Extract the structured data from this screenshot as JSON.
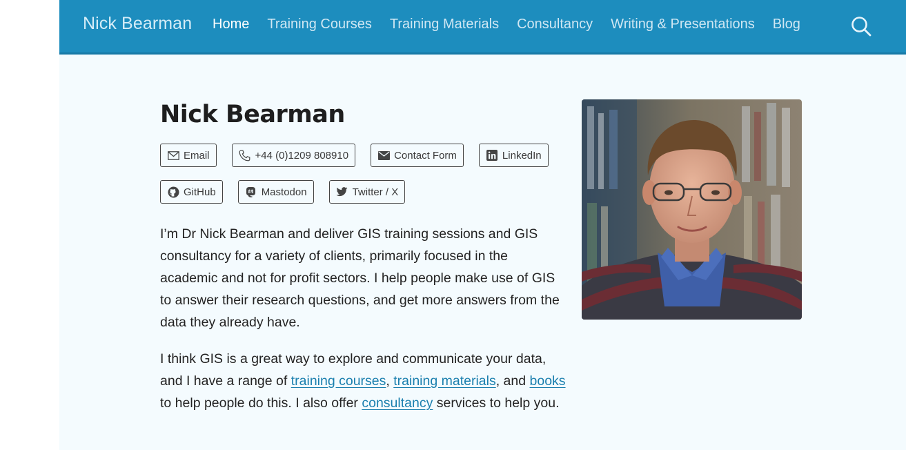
{
  "nav": {
    "brand": "Nick Bearman",
    "links": [
      {
        "label": "Home",
        "active": true
      },
      {
        "label": "Training Courses"
      },
      {
        "label": "Training Materials"
      },
      {
        "label": "Consultancy"
      },
      {
        "label": "Writing & Presentations"
      },
      {
        "label": "Blog"
      }
    ],
    "search_icon": "search-icon"
  },
  "main": {
    "title": "Nick Bearman",
    "contacts_row1": [
      {
        "label": "Email",
        "icon": "envelope-icon"
      },
      {
        "label": "+44 (0)1209 808910",
        "icon": "phone-icon"
      },
      {
        "label": "Contact Form",
        "icon": "envelope-filled-icon"
      },
      {
        "label": "LinkedIn",
        "icon": "linkedin-icon"
      }
    ],
    "contacts_row2": [
      {
        "label": "GitHub",
        "icon": "github-icon"
      },
      {
        "label": "Mastodon",
        "icon": "mastodon-icon"
      },
      {
        "label": "Twitter / X",
        "icon": "twitter-icon"
      }
    ],
    "para1": "I’m Dr Nick Bearman and deliver GIS training sessions and GIS consultancy for a variety of clients, primarily focused in the academic and not for profit sectors. I help people make use of GIS to answer their research questions, and get more answers from the data they already have.",
    "para2": {
      "t1": "I think GIS is a great way to explore and communicate your data, and I have a range of ",
      "link1": "training courses",
      "t2": ", ",
      "link2": "training materials",
      "t3": ", and ",
      "link3": "books",
      "t4": " to help people do this. I also offer ",
      "link4": "consultancy",
      "t5": " services to help you."
    }
  },
  "colors": {
    "nav_bg": "#1d8dbe",
    "page_bg": "#f4fbfe",
    "link": "#1a7fae"
  }
}
